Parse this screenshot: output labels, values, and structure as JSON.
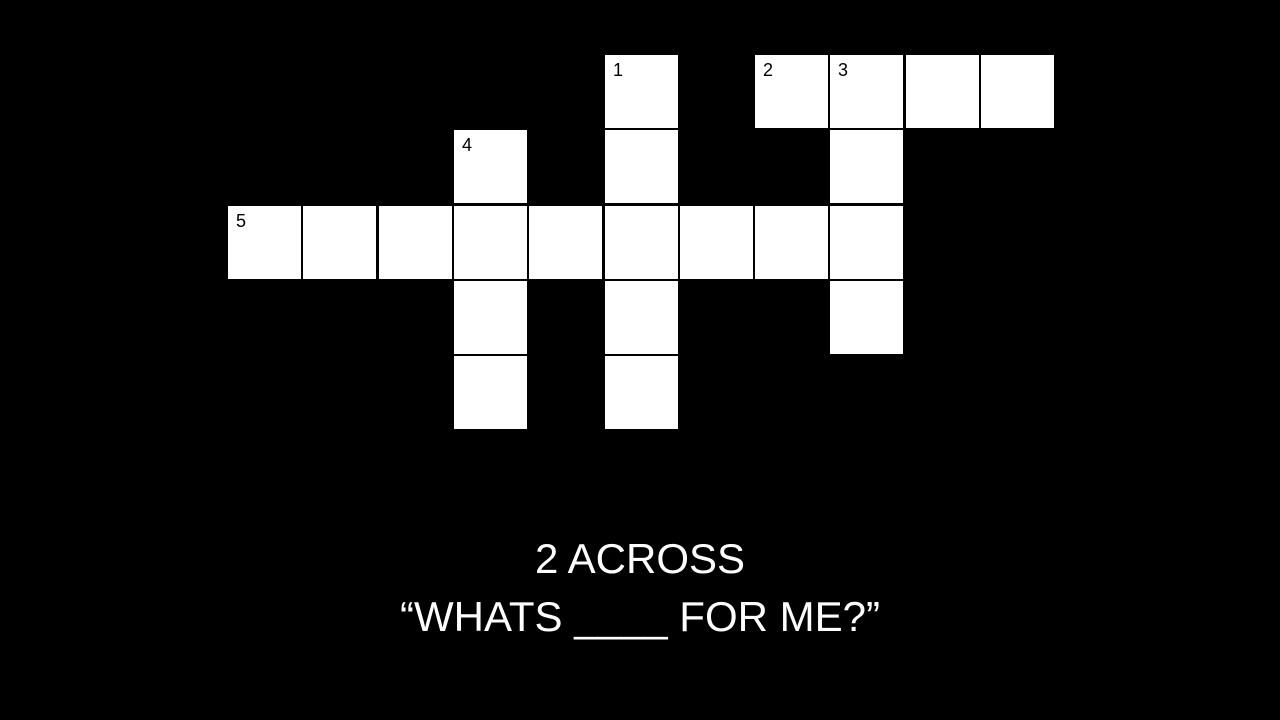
{
  "puzzle": {
    "colors": {
      "background": "#000000",
      "cell": "#ffffff",
      "text": "#ffffff"
    },
    "grid": {
      "cols": 11,
      "rows": 5,
      "cells": [
        {
          "r": 0,
          "c": 5,
          "n": "1"
        },
        {
          "r": 0,
          "c": 7,
          "n": "2"
        },
        {
          "r": 0,
          "c": 8,
          "n": "3"
        },
        {
          "r": 0,
          "c": 9
        },
        {
          "r": 0,
          "c": 10
        },
        {
          "r": 1,
          "c": 3,
          "n": "4"
        },
        {
          "r": 1,
          "c": 5
        },
        {
          "r": 1,
          "c": 8
        },
        {
          "r": 2,
          "c": 0,
          "n": "5"
        },
        {
          "r": 2,
          "c": 1
        },
        {
          "r": 2,
          "c": 2
        },
        {
          "r": 2,
          "c": 3
        },
        {
          "r": 2,
          "c": 4
        },
        {
          "r": 2,
          "c": 5
        },
        {
          "r": 2,
          "c": 6
        },
        {
          "r": 2,
          "c": 7
        },
        {
          "r": 2,
          "c": 8
        },
        {
          "r": 3,
          "c": 3
        },
        {
          "r": 3,
          "c": 5
        },
        {
          "r": 3,
          "c": 8
        },
        {
          "r": 4,
          "c": 3
        },
        {
          "r": 4,
          "c": 5
        }
      ]
    },
    "clue": {
      "heading": "2 ACROSS",
      "text": "“WHATS ____ FOR ME?”"
    }
  }
}
